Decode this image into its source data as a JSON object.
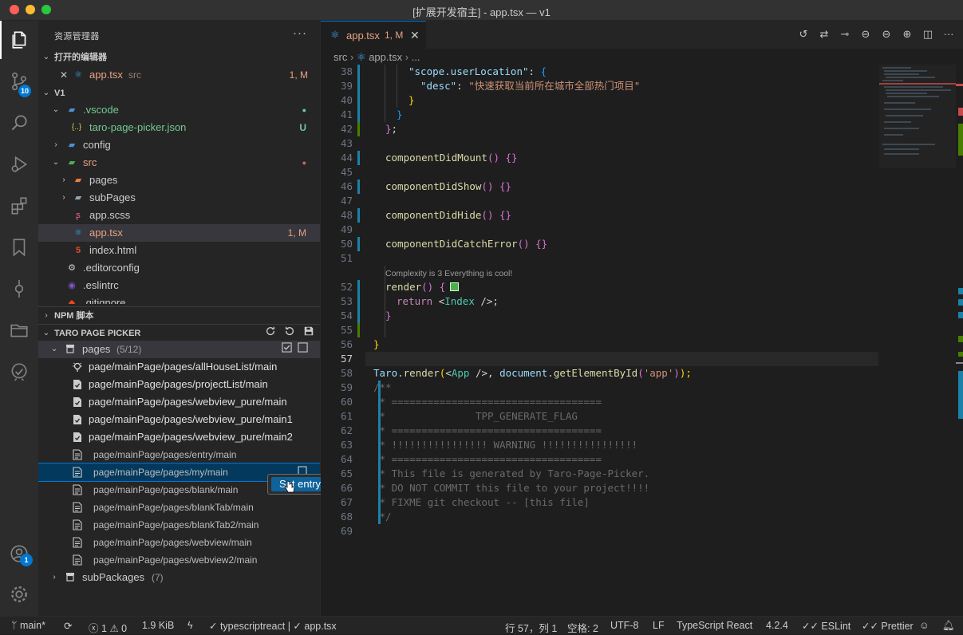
{
  "window": {
    "title": "[扩展开发宿主] - app.tsx — v1"
  },
  "activity": {
    "scm_badge": "10",
    "accounts_badge": "1"
  },
  "sidebar": {
    "title": "资源管理器",
    "more": "···",
    "open_editors": {
      "header": "打开的编辑器",
      "items": [
        {
          "name": "app.tsx",
          "dir": "src",
          "status": "1, M",
          "close": "✕"
        }
      ]
    },
    "workspace": {
      "header": "V1",
      "rows": [
        {
          "name": ".vscode",
          "color": "#73c991",
          "deco": "●",
          "deco_color": "#73c991"
        },
        {
          "name": "taro-page-picker.json",
          "color": "#73c991",
          "deco": "U",
          "deco_color": "#73c991",
          "icon": "{..}"
        },
        {
          "name": "config",
          "color": "#cccccc"
        },
        {
          "name": "src",
          "color": "#e8a282",
          "deco": "●",
          "deco_color": "#c96b5d"
        },
        {
          "name": "pages",
          "color": "#cccccc"
        },
        {
          "name": "subPages",
          "color": "#cccccc"
        },
        {
          "name": "app.scss",
          "color": "#cccccc"
        },
        {
          "name": "app.tsx",
          "color": "#e8a282",
          "deco": "1, M",
          "deco_color": "#e8a282"
        },
        {
          "name": "index.html",
          "color": "#cccccc"
        },
        {
          "name": ".editorconfig",
          "color": "#cccccc"
        },
        {
          "name": ".eslintrc",
          "color": "#cccccc"
        },
        {
          "name": ".gitignore",
          "color": "#cccccc"
        }
      ]
    },
    "npm": {
      "header": "NPM 脚本"
    },
    "picker": {
      "header": "TARO PAGE PICKER",
      "pages_label": "pages",
      "pages_count": "(5/12)",
      "pages": [
        {
          "path": "page/mainPage/pages/allHouseList/main",
          "checked": true
        },
        {
          "path": "page/mainPage/pages/projectList/main",
          "checked": true
        },
        {
          "path": "page/mainPage/pages/webview_pure/main",
          "checked": true
        },
        {
          "path": "page/mainPage/pages/webview_pure/main1",
          "checked": true
        },
        {
          "path": "page/mainPage/pages/webview_pure/main2",
          "checked": true
        },
        {
          "path": "page/mainPage/pages/entry/main",
          "checked": false
        },
        {
          "path": "page/mainPage/pages/my/main",
          "checked": false
        },
        {
          "path": "page/mainPage/pages/blank/main",
          "checked": false
        },
        {
          "path": "page/mainPage/pages/blankTab/main",
          "checked": false
        },
        {
          "path": "page/mainPage/pages/blankTab2/main",
          "checked": false
        },
        {
          "path": "page/mainPage/pages/webview/main",
          "checked": false
        },
        {
          "path": "page/mainPage/pages/webview2/main",
          "checked": false
        }
      ],
      "subpackages_label": "subPackages",
      "subpackages_count": "(7)",
      "tooltip": "Set entry"
    }
  },
  "editor": {
    "tab": {
      "label": "app.tsx",
      "status": "1, M",
      "close": "✕"
    },
    "breadcrumb": {
      "folder": "src",
      "file": "app.tsx",
      "more": "..."
    },
    "lines": [
      "38",
      "39",
      "40",
      "41",
      "42",
      "43",
      "44",
      "45",
      "46",
      "47",
      "48",
      "49",
      "50",
      "51",
      "52",
      "53",
      "54",
      "55",
      "56",
      "57",
      "58",
      "59",
      "60",
      "61",
      "62",
      "63",
      "64",
      "65",
      "66",
      "67",
      "68",
      "69"
    ],
    "hint": "Complexity is 3 Everything is cool!",
    "code": {
      "l38a": "\"scope.userLocation\"",
      "l38b": ": ",
      "l38c": "{",
      "l39a": "\"desc\"",
      "l39b": ": ",
      "l39c": "\"快速获取当前所在城市全部热门项目\"",
      "l40": "}",
      "l41": "}",
      "l42a": "}",
      "l42b": ";",
      "l44a": "componentDidMount",
      "l44b": "() {}",
      "l46a": "componentDidShow",
      "l46b": "() {}",
      "l48a": "componentDidHide",
      "l48b": "() {}",
      "l50a": "componentDidCatchError",
      "l50b": "() {}",
      "l52a": "render",
      "l52b": "() {",
      "l53a": "return ",
      "l53b": "<",
      "l53c": "Index",
      "l53d": " />;",
      "l54": "}",
      "l56": "}",
      "l58a": "Taro",
      "l58b": ".",
      "l58c": "render",
      "l58d": "(",
      "l58e": "<",
      "l58f": "App",
      "l58g": " />, ",
      "l58h": "document",
      "l58i": ".",
      "l58j": "getElementById",
      "l58k": "(",
      "l58l": "'app'",
      "l58m": ")",
      "l58n": ");",
      "l59": "/**",
      "l60": " * ===================================",
      "l61": " *               TPP_GENERATE_FLAG",
      "l62": " * ===================================",
      "l63": " * !!!!!!!!!!!!!!!! WARNING !!!!!!!!!!!!!!!!",
      "l64": " * ===================================",
      "l65": " * This file is generated by Taro-Page-Picker.",
      "l66": " * DO NOT COMMIT this file to your project!!!!",
      "l67": " * FIXME git checkout -- [this file]",
      "l68": " */"
    }
  },
  "status": {
    "branch": "main*",
    "errors": "1",
    "warnings": "0",
    "size": "1.9 KiB",
    "lang_check": "typescriptreact | ✓ app.tsx",
    "position": "行 57，列 1",
    "spaces": "空格: 2",
    "encoding": "UTF-8",
    "eol": "LF",
    "language": "TypeScript React",
    "ts_version": "4.2.4",
    "eslint": "ESLint",
    "prettier": "Prettier"
  }
}
